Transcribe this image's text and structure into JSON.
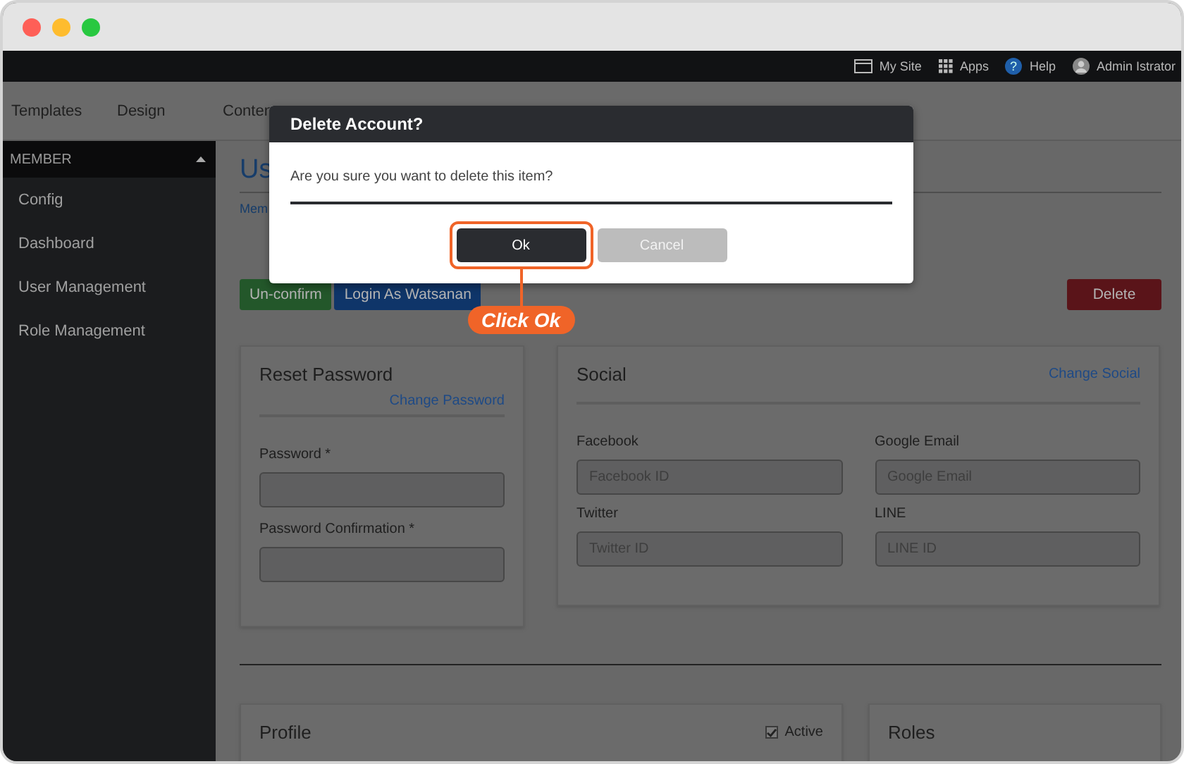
{
  "browser": {
    "traffic_lights": [
      {
        "color": "#fe5f57"
      },
      {
        "color": "#febc2e"
      },
      {
        "color": "#28c840"
      }
    ]
  },
  "top_bar": {
    "links": [
      {
        "kind": "site",
        "label": "My Site"
      },
      {
        "kind": "apps",
        "label": "Apps"
      },
      {
        "kind": "help",
        "label": "Help",
        "glyph": "?"
      },
      {
        "kind": "user",
        "label": "Admin Istrator"
      }
    ]
  },
  "nav": {
    "items": [
      "Templates",
      "Design",
      "Conten"
    ]
  },
  "sidebar": {
    "header": "MEMBER",
    "expanded": true,
    "items": [
      "Config",
      "Dashboard",
      "User Management",
      "Role Management"
    ]
  },
  "page": {
    "title": "Us",
    "breadcrumb": "Mem",
    "actions": [
      {
        "kind": "success",
        "label": "Un-confirm"
      },
      {
        "kind": "primary",
        "label": "Login As Watsanan"
      }
    ],
    "delete_button": "Delete"
  },
  "reset_password": {
    "title": "Reset Password",
    "link": "Change Password",
    "fields": [
      {
        "label": "Password *"
      },
      {
        "label": "Password Confirmation *"
      }
    ]
  },
  "social": {
    "title": "Social",
    "link": "Change Social",
    "fields": [
      {
        "label": "Facebook",
        "placeholder": "Facebook ID"
      },
      {
        "label": "Google Email",
        "placeholder": "Google Email"
      },
      {
        "label": "Twitter",
        "placeholder": "Twitter ID"
      },
      {
        "label": "LINE",
        "placeholder": "LINE ID"
      }
    ]
  },
  "profile": {
    "title": "Profile",
    "active": {
      "label": "Active",
      "checked": true
    }
  },
  "roles": {
    "title": "Roles"
  },
  "dialog": {
    "title": "Delete Account?",
    "message": "Are you sure you want to delete this item?",
    "buttons": [
      {
        "kind": "confirm",
        "label": "Ok",
        "highlighted": true
      },
      {
        "kind": "cancel",
        "label": "Cancel",
        "highlighted": false
      }
    ]
  },
  "callout": {
    "label": "Click Ok"
  }
}
